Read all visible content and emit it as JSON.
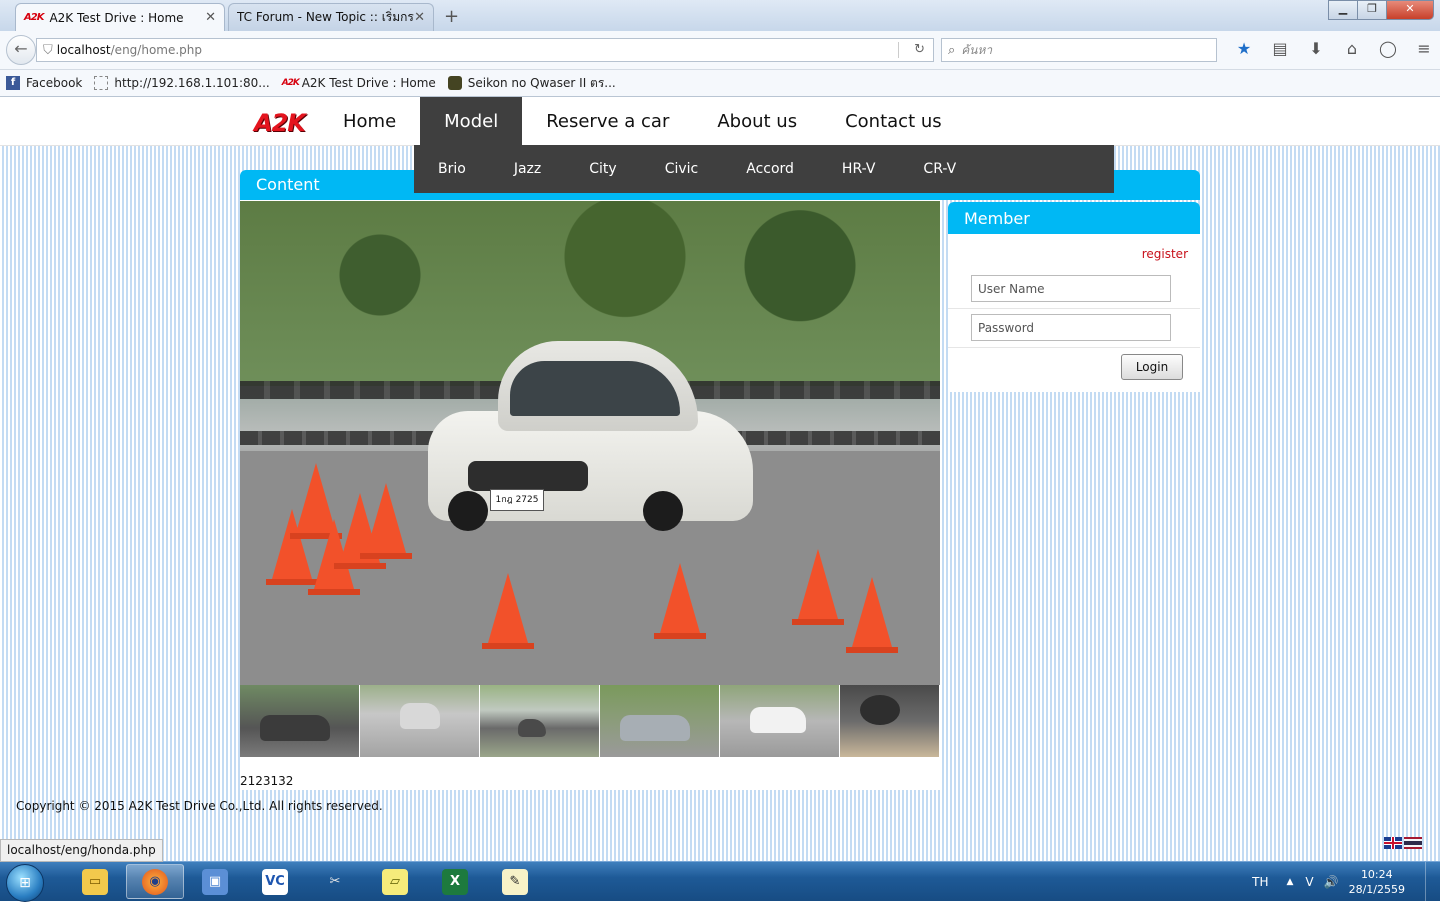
{
  "browser": {
    "tabs": [
      {
        "title": "A2K Test Drive : Home",
        "favicon": "A2K",
        "active": true
      },
      {
        "title": "TC Forum - New Topic :: เริ่มกระ...",
        "active": false
      }
    ],
    "new_tab": "+",
    "window_controls": {
      "minimize": "▁",
      "maximize": "❐",
      "close": "✕"
    },
    "url": {
      "host": "localhost",
      "path": "/eng/home.php"
    },
    "search_placeholder": "ค้นหา",
    "bookmarks": [
      {
        "label": "Facebook",
        "icon": "facebook-icon"
      },
      {
        "label": "http://192.168.1.101:80...",
        "icon": "blank-page-icon"
      },
      {
        "label": "A2K Test Drive : Home",
        "icon": "a2k-icon"
      },
      {
        "label": "Seikon no Qwaser II ตร...",
        "icon": "anime-icon"
      }
    ],
    "status_url": "localhost/eng/honda.php"
  },
  "site": {
    "logo": "A2K",
    "menu": [
      "Home",
      "Model",
      "Reserve a car",
      "About us",
      "Contact us"
    ],
    "active_menu": "Model",
    "submenu": [
      "Brio",
      "Jazz",
      "City",
      "Civic",
      "Accord",
      "HR-V",
      "CR-V"
    ],
    "content_title": "Content",
    "photo_plate": "1กฎ 2725",
    "counter": "2123132",
    "copyright": "Copyright © 2015 A2K Test Drive Co.,Ltd. All rights reserved.",
    "member": {
      "title": "Member",
      "register": "register",
      "username_placeholder": "User Name",
      "password_placeholder": "Password",
      "login": "Login"
    }
  },
  "taskbar": {
    "language": "TH",
    "time": "10:24",
    "date": "28/1/2559"
  },
  "colors": {
    "accent": "#00b8f4",
    "menu_dark": "#3f3f3f",
    "logo_red": "#e4141e",
    "register_red": "#c8101a"
  }
}
